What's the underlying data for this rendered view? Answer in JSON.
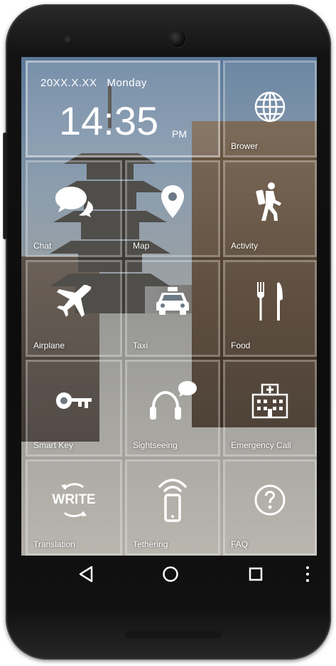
{
  "status": {
    "date": "20XX.X.XX",
    "weekday": "Monday",
    "time": "14:35",
    "ampm": "PM"
  },
  "tiles": [
    {
      "label": "Brower",
      "icon": "globe-icon"
    },
    {
      "label": "Chat",
      "icon": "chat-bubbles-icon"
    },
    {
      "label": "Map",
      "icon": "map-pin-icon"
    },
    {
      "label": "Activity",
      "icon": "hiker-icon"
    },
    {
      "label": "Airplane",
      "icon": "airplane-icon"
    },
    {
      "label": "Taxi",
      "icon": "taxi-icon"
    },
    {
      "label": "Food",
      "icon": "fork-knife-icon"
    },
    {
      "label": "Smart Key",
      "icon": "key-icon"
    },
    {
      "label": "Sightseeing",
      "icon": "headphones-chat-icon"
    },
    {
      "label": "Emergency Call",
      "icon": "hospital-icon"
    },
    {
      "label": "Translation",
      "icon": "translate-cycle-icon",
      "icon_text": "WRITE"
    },
    {
      "label": "Tethering",
      "icon": "phone-wifi-icon"
    },
    {
      "label": "FAQ",
      "icon": "question-circle-icon"
    }
  ],
  "navbar": {
    "back": "back-icon",
    "home": "home-icon",
    "recent": "recent-apps-icon",
    "more": "more-icon"
  },
  "colors": {
    "tile_text": "#ffffff",
    "phone_body": "#0c0c0c",
    "tile_overlay": "rgba(255,255,255,0.10)"
  }
}
